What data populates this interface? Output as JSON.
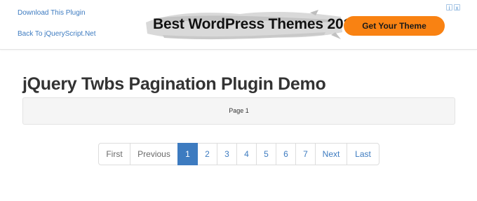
{
  "header": {
    "links": [
      {
        "label": "Download This Plugin"
      },
      {
        "label": "Back To jQueryScript.Net"
      }
    ]
  },
  "ad": {
    "headline": "Best WordPress Themes 2016",
    "cta": "Get Your Theme",
    "choices": [
      "i",
      "x"
    ]
  },
  "main": {
    "title": "jQuery Twbs Pagination Plugin Demo",
    "content": "Page 1"
  },
  "pagination": {
    "active_page": "1",
    "items": [
      {
        "label": "First",
        "state": "disabled"
      },
      {
        "label": "Previous",
        "state": "disabled"
      },
      {
        "label": "1",
        "state": "active"
      },
      {
        "label": "2",
        "state": "normal"
      },
      {
        "label": "3",
        "state": "normal"
      },
      {
        "label": "4",
        "state": "normal"
      },
      {
        "label": "5",
        "state": "normal"
      },
      {
        "label": "6",
        "state": "normal"
      },
      {
        "label": "7",
        "state": "normal"
      },
      {
        "label": "Next",
        "state": "normal"
      },
      {
        "label": "Last",
        "state": "normal"
      }
    ]
  },
  "colors": {
    "link": "#3d7bc0",
    "active": "#3d7bc0",
    "cta": "#f98212"
  }
}
